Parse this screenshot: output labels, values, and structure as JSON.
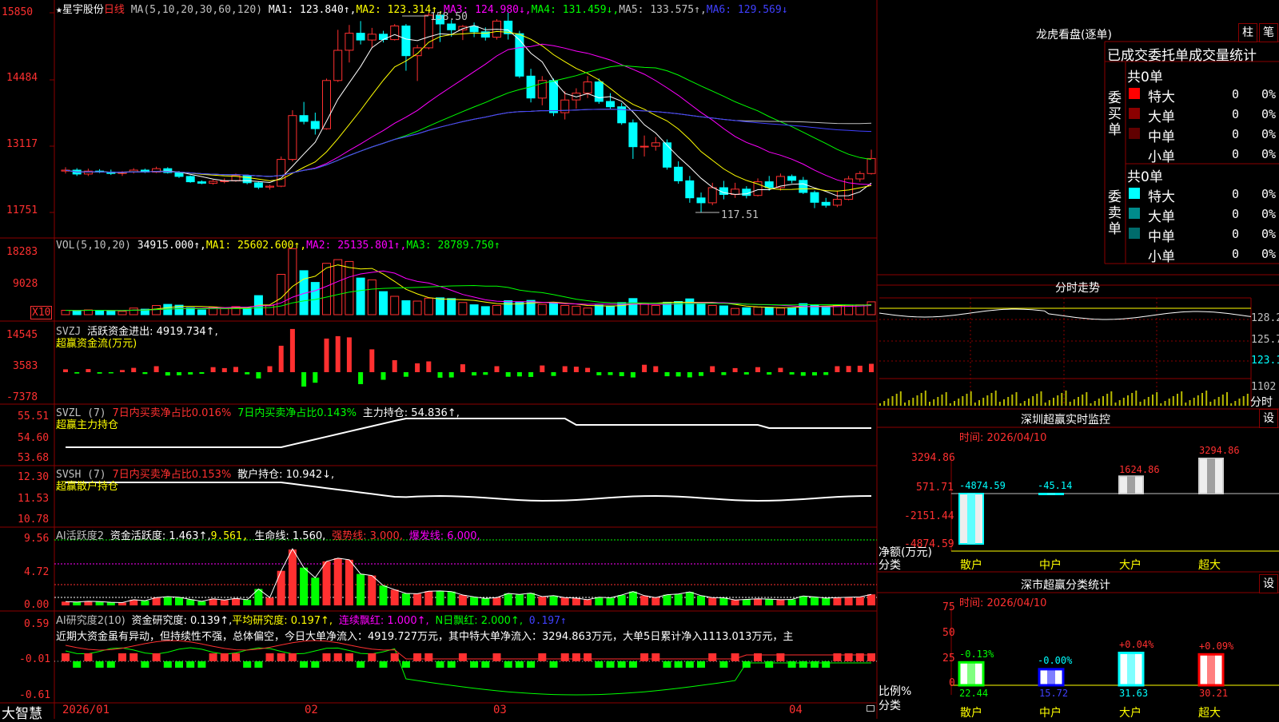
{
  "app": {
    "name": "大智慧"
  },
  "colors": {
    "up": "#ff3030",
    "down": "#00ffff",
    "ma1": "#ffffff",
    "ma2": "#ffff00",
    "ma3": "#ff00ff",
    "ma4": "#00ff00",
    "ma5": "#c0c0c0",
    "ma6": "#4040ff",
    "grid": "#8b0000"
  },
  "price_panel": {
    "star": "★",
    "stock_name": "星宇股份",
    "period": "日线",
    "ma_params": "MA(5,10,20,30,60,120)",
    "ma1": "MA1: 123.840↑,",
    "ma2": "MA2: 123.314↑,",
    "ma3": "MA3: 124.980↓,",
    "ma4": "MA4: 131.459↓,",
    "ma5": "MA5: 133.575↑,",
    "ma6": "MA6: 129.569↓",
    "y_ticks": [
      "15850",
      "14484",
      "13117",
      "11751"
    ],
    "high_label": "158.50",
    "low_label": "117.51"
  },
  "volume_panel": {
    "title": "VOL(5,10,20)",
    "value": "34915.000↑,",
    "ma1": "MA1: 25602.600↑,",
    "ma2": "MA2: 25135.801↑,",
    "ma3": "MA3: 28789.750↑",
    "y_ticks": [
      "18283",
      "9028"
    ],
    "unit": "X10"
  },
  "svzj_panel": {
    "title": "SVZJ",
    "label": "活跃资金进出: 4919.734↑,",
    "sub": "超赢资金流(万元)",
    "y_ticks": [
      "14545",
      "3583",
      "-7378"
    ]
  },
  "svzl_panel": {
    "title": "SVZL (7)",
    "a": "7日内买卖净占比0.016%",
    "b": "7日内买卖净占比0.143%",
    "c": "主力持仓: 54.836↑,",
    "sub": "超赢主力持仓",
    "y_ticks": [
      "55.51",
      "54.60",
      "53.68"
    ]
  },
  "svsh_panel": {
    "title": "SVSH (7)",
    "a": "7日内买卖净占比0.153%",
    "c": "散户持仓: 10.942↓,",
    "sub": "超赢散户持仓",
    "y_ticks": [
      "12.30",
      "11.53",
      "10.78"
    ]
  },
  "active_panel": {
    "title": "AI活跃度2",
    "a": "资金活跃度: 1.463↑,",
    "b": "9.561,",
    "c": "生命线: 1.560,",
    "d": "强势线: 3.000,",
    "e": "爆发线: 6.000,",
    "y_ticks": [
      "9.56",
      "4.72",
      "0.00"
    ]
  },
  "research_panel": {
    "title": "AI研究度2(10)",
    "a": "资金研究度: 0.139↑,",
    "b": "平均研究度: 0.197↑,",
    "c": "连续飘红: 1.000↑,",
    "d": "N日飘红: 2.000↑,",
    "e": "0.197↑",
    "text": "近期大资金虽有异动，但持续性不强，总体偏空，今日大单净流入：4919.727万元，其中特大单净流入：3294.863万元，大单5日累计净入1113.013万元，主",
    "y_ticks": [
      "0.59",
      "-0.01",
      "-0.61"
    ]
  },
  "x_axis": [
    "2026/01",
    "02",
    "03",
    "04"
  ],
  "right_panel": {
    "lhb": {
      "title": "龙虎看盘(逐单)",
      "btn1": "柱",
      "btn2": "笔",
      "stats_title": "已成交委托单成交量统计",
      "buy_label": "委买单",
      "sell_label": "委卖单",
      "buy_total": "共0单",
      "sell_total": "共0单",
      "rows": [
        {
          "label": "特大",
          "count": "0",
          "pct": "0%",
          "color_buy": "#ff0000",
          "color_sell": "#00ffff"
        },
        {
          "label": "大单",
          "count": "0",
          "pct": "0%",
          "color_buy": "#8b0000",
          "color_sell": "#008b8b"
        },
        {
          "label": "中单",
          "count": "0",
          "pct": "0%",
          "color_buy": "#600000",
          "color_sell": "#006b6b"
        },
        {
          "label": "小单",
          "count": "0",
          "pct": "0%",
          "color_buy": "",
          "color_sell": ""
        }
      ]
    },
    "intraday": {
      "title": "分时走势",
      "y_ticks": [
        "128.2",
        "125.7",
        "123.1",
        "1102"
      ],
      "unit": "分时"
    },
    "monitor": {
      "title": "深圳超赢实时监控",
      "btn": "设",
      "time": "时间: 2026/04/10",
      "y_ticks": [
        "3294.86",
        "571.71",
        "-2151.44",
        "-4874.59"
      ],
      "axis_label": "净额(万元)",
      "cat_label": "分类",
      "categories": [
        "散户",
        "中户",
        "大户",
        "超大"
      ],
      "values": [
        -4874.59,
        -45.14,
        1624.86,
        3294.86
      ],
      "value_labels": [
        "-4874.59",
        "-45.14",
        "1624.86",
        "3294.86"
      ]
    },
    "classify": {
      "title": "深市超赢分类统计",
      "btn": "设",
      "time": "时间: 2026/04/10",
      "y_ticks": [
        "75",
        "50",
        "25",
        "0"
      ],
      "axis_label": "比例%",
      "cat_label": "分类",
      "categories": [
        "散户",
        "中户",
        "大户",
        "超大"
      ],
      "values": [
        22.44,
        15.72,
        31.63,
        30.21
      ],
      "value_labels": [
        "22.44",
        "15.72",
        "31.63",
        "30.21"
      ],
      "change_labels": [
        "-0.13%",
        "-0.00%",
        "+0.04%",
        "+0.09%"
      ]
    }
  },
  "chart_data": [
    {
      "type": "candlestick",
      "title": "星宇股份 日线",
      "ylim": [
        117.51,
        158.5
      ],
      "candles": [
        [
          126.0,
          126.8,
          125.5,
          126.2
        ],
        [
          126.2,
          126.6,
          125.0,
          125.4
        ],
        [
          125.4,
          126.5,
          125.0,
          126.0
        ],
        [
          126.0,
          126.4,
          125.6,
          125.8
        ],
        [
          125.8,
          126.3,
          125.2,
          125.5
        ],
        [
          125.5,
          126.0,
          125.0,
          125.8
        ],
        [
          125.8,
          126.6,
          125.5,
          126.2
        ],
        [
          126.2,
          126.5,
          125.6,
          125.8
        ],
        [
          125.8,
          126.9,
          125.6,
          126.5
        ],
        [
          126.5,
          126.8,
          125.5,
          125.7
        ],
        [
          125.7,
          126.0,
          124.6,
          124.9
        ],
        [
          124.9,
          125.1,
          123.6,
          123.8
        ],
        [
          123.8,
          124.1,
          123.3,
          123.5
        ],
        [
          123.5,
          124.2,
          123.2,
          123.9
        ],
        [
          123.9,
          124.5,
          123.5,
          124.0
        ],
        [
          124.0,
          125.5,
          123.8,
          125.1
        ],
        [
          125.1,
          125.3,
          123.3,
          123.6
        ],
        [
          123.6,
          123.8,
          122.3,
          122.7
        ],
        [
          122.7,
          123.2,
          122.2,
          122.9
        ],
        [
          122.9,
          129.0,
          122.7,
          128.4
        ],
        [
          128.4,
          138.5,
          128.0,
          137.4
        ],
        [
          137.4,
          140.2,
          135.6,
          136.2
        ],
        [
          136.2,
          138.0,
          133.5,
          134.7
        ],
        [
          134.7,
          145.0,
          134.5,
          144.6
        ],
        [
          144.6,
          155.0,
          144.3,
          150.8
        ],
        [
          150.8,
          156.0,
          148.3,
          154.3
        ],
        [
          154.3,
          156.8,
          152.0,
          152.9
        ],
        [
          152.9,
          155.4,
          151.4,
          154.1
        ],
        [
          154.1,
          154.8,
          152.4,
          153.0
        ],
        [
          153.0,
          156.2,
          152.8,
          155.8
        ],
        [
          155.8,
          156.2,
          146.6,
          149.7
        ],
        [
          149.7,
          151.9,
          144.5,
          151.3
        ],
        [
          151.3,
          158.5,
          151.0,
          158.0
        ],
        [
          158.0,
          158.5,
          152.5,
          156.2
        ],
        [
          156.2,
          157.0,
          153.6,
          155.0
        ],
        [
          155.0,
          156.0,
          152.9,
          155.7
        ],
        [
          155.7,
          156.5,
          153.5,
          154.6
        ],
        [
          154.6,
          155.5,
          152.8,
          153.5
        ],
        [
          153.5,
          157.2,
          153.0,
          156.8
        ],
        [
          156.8,
          158.5,
          153.0,
          154.2
        ],
        [
          154.2,
          154.8,
          145.1,
          145.5
        ],
        [
          145.5,
          147.0,
          140.1,
          141.0
        ],
        [
          141.0,
          145.5,
          139.5,
          144.6
        ],
        [
          144.6,
          145.0,
          137.3,
          138.0
        ],
        [
          138.0,
          142.4,
          136.6,
          140.6
        ],
        [
          140.6,
          143.0,
          138.8,
          142.0
        ],
        [
          142.0,
          145.5,
          141.0,
          144.3
        ],
        [
          144.3,
          145.0,
          139.8,
          140.3
        ],
        [
          140.3,
          142.0,
          138.8,
          139.2
        ],
        [
          139.2,
          140.0,
          135.5,
          135.9
        ],
        [
          135.9,
          136.6,
          128.5,
          131.0
        ],
        [
          131.0,
          133.3,
          129.0,
          131.1
        ],
        [
          131.1,
          133.0,
          130.2,
          131.8
        ],
        [
          131.8,
          132.5,
          126.3,
          126.8
        ],
        [
          126.8,
          128.0,
          123.4,
          124.0
        ],
        [
          124.0,
          125.0,
          119.5,
          120.5
        ],
        [
          120.5,
          121.6,
          117.5,
          119.5
        ],
        [
          119.5,
          123.6,
          119.0,
          122.6
        ],
        [
          122.6,
          124.0,
          120.2,
          121.2
        ],
        [
          121.2,
          123.6,
          120.5,
          122.3
        ],
        [
          122.3,
          122.9,
          120.4,
          121.0
        ],
        [
          121.0,
          124.5,
          120.8,
          123.8
        ],
        [
          123.8,
          125.0,
          122.0,
          122.6
        ],
        [
          122.6,
          125.5,
          122.0,
          124.9
        ],
        [
          124.9,
          125.3,
          123.5,
          124.1
        ],
        [
          124.1,
          124.8,
          121.3,
          121.6
        ],
        [
          121.6,
          122.0,
          118.4,
          119.6
        ],
        [
          119.6,
          120.5,
          118.5,
          119.0
        ],
        [
          119.0,
          122.0,
          118.6,
          120.2
        ],
        [
          120.2,
          125.0,
          120.0,
          124.4
        ],
        [
          124.4,
          126.0,
          123.8,
          125.5
        ],
        [
          125.5,
          130.4,
          125.3,
          128.6
        ]
      ]
    },
    {
      "type": "bar",
      "title": "VOL(5,10,20)",
      "ylim": [
        0,
        18283
      ],
      "values": [
        1200,
        1100,
        1300,
        1200,
        1000,
        900,
        1800,
        1500,
        2500,
        2800,
        2600,
        1900,
        1300,
        2100,
        1700,
        2200,
        1800,
        5200,
        2500,
        11000,
        18000,
        12000,
        8800,
        14000,
        15000,
        14500,
        10000,
        9500,
        6300,
        5000,
        3800,
        3700,
        4500,
        4600,
        4400,
        3300,
        2700,
        2200,
        2500,
        3800,
        3500,
        3900,
        2800,
        3100,
        2500,
        2300,
        1800,
        2600,
        2400,
        3300,
        4400,
        3100,
        2500,
        3400,
        3600,
        4300,
        3100,
        2500,
        2400,
        1700,
        1900,
        2100,
        2000,
        1800,
        1900,
        3000,
        2700,
        2300,
        2500,
        2600,
        2700,
        3500
      ]
    }
  ]
}
